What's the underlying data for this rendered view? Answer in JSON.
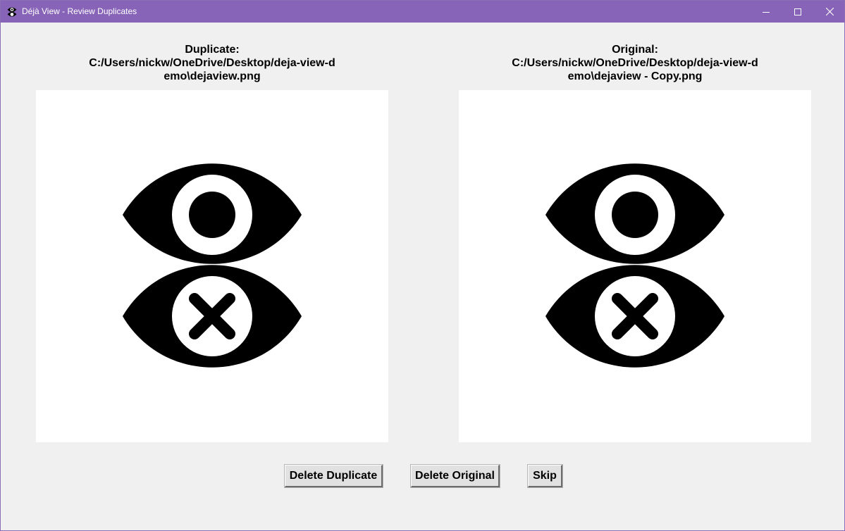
{
  "window": {
    "title": "Déjà View - Review Duplicates",
    "app_icon": "deja-view-logo-icon",
    "controls": {
      "minimize_icon": "minimize-icon",
      "maximize_icon": "maximize-icon",
      "close_icon": "close-icon"
    },
    "titlebar_color": "#8764b8"
  },
  "duplicate": {
    "heading": "Duplicate:",
    "path_line1": "C:/Users/nickw/OneDrive/Desktop/deja-view-d",
    "path_line2": "emo\\dejaview.png",
    "image_icon": "deja-view-logo-icon"
  },
  "original": {
    "heading": "Original:",
    "path_line1": "C:/Users/nickw/OneDrive/Desktop/deja-view-d",
    "path_line2": "emo\\dejaview - Copy.png",
    "image_icon": "deja-view-logo-icon"
  },
  "actions": {
    "delete_duplicate": "Delete Duplicate",
    "delete_original": "Delete Original",
    "skip": "Skip"
  }
}
